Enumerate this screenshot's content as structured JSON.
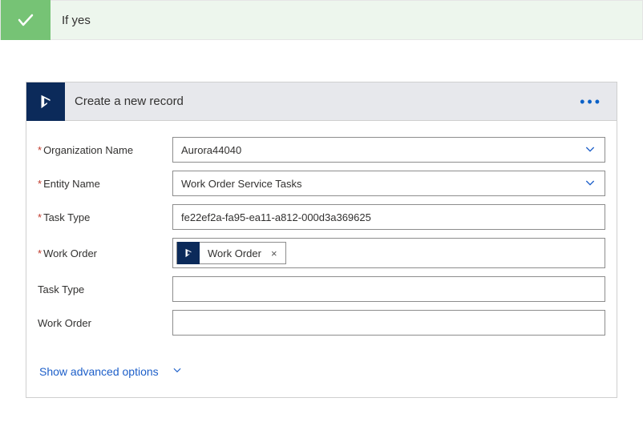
{
  "condition": {
    "title": "If yes"
  },
  "action": {
    "title": "Create a new record"
  },
  "fields": {
    "orgName": {
      "label": "Organization Name",
      "value": "Aurora44040",
      "required": true,
      "dropdown": true
    },
    "entityName": {
      "label": "Entity Name",
      "value": "Work Order Service Tasks",
      "required": true,
      "dropdown": true
    },
    "taskTypeReq": {
      "label": "Task Type",
      "value": "fe22ef2a-fa95-ea11-a812-000d3a369625",
      "required": true
    },
    "workOrderReq": {
      "label": "Work Order",
      "tokenLabel": "Work Order",
      "required": true
    },
    "taskType": {
      "label": "Task Type",
      "value": ""
    },
    "workOrder": {
      "label": "Work Order",
      "value": ""
    }
  },
  "advanced": {
    "label": "Show advanced options"
  }
}
